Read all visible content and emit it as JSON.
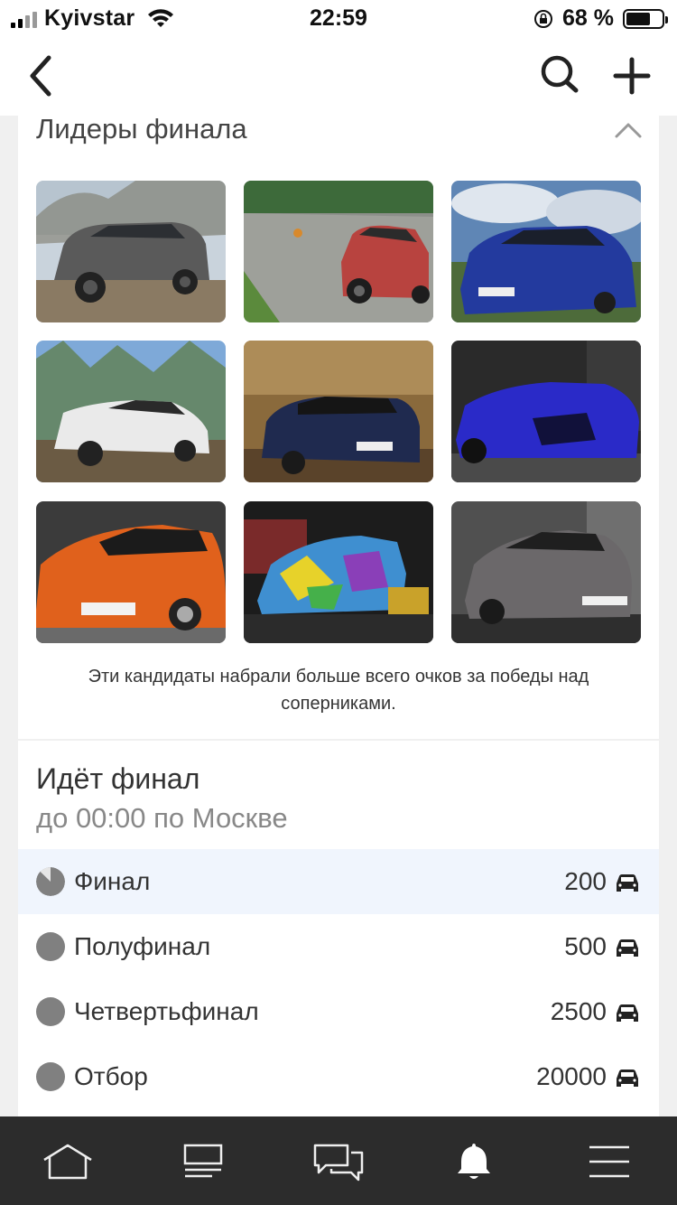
{
  "status_bar": {
    "carrier": "Kyivstar",
    "time": "22:59",
    "battery_percent": "68 %",
    "battery_level": 0.68
  },
  "nav": {
    "back_icon": "chevron-left-icon",
    "search_icon": "search-icon",
    "add_icon": "plus-icon"
  },
  "leaders": {
    "title": "Лидеры финала",
    "collapse_icon": "chevron-up-icon",
    "photos": [
      "grey-suv-photo",
      "red-suv-photo",
      "blue-sedan-photo",
      "white-sedan-photo",
      "dark-hatchback-photo",
      "blue-convertible-photo",
      "orange-hatchback-photo",
      "camo-coupe-photo",
      "grey-sedan-photo"
    ],
    "caption": "Эти кандидаты набрали больше всего очков за победы над соперниками."
  },
  "final": {
    "title": "Идёт финал",
    "subtitle": "до 00:00 по Москве",
    "stages": [
      {
        "label": "Финал",
        "count": "200",
        "active": true
      },
      {
        "label": "Полуфинал",
        "count": "500",
        "active": false
      },
      {
        "label": "Четвертьфинал",
        "count": "2500",
        "active": false
      },
      {
        "label": "Отбор",
        "count": "20000",
        "active": false
      }
    ]
  },
  "tab_bar": {
    "tabs": [
      "home-icon",
      "feed-icon",
      "messages-icon",
      "notifications-icon",
      "menu-icon"
    ]
  },
  "colors": {
    "background": "#f0f0f0",
    "active_row": "#f0f5fd",
    "tab_bar": "#2c2c2c",
    "dot": "#808080"
  }
}
